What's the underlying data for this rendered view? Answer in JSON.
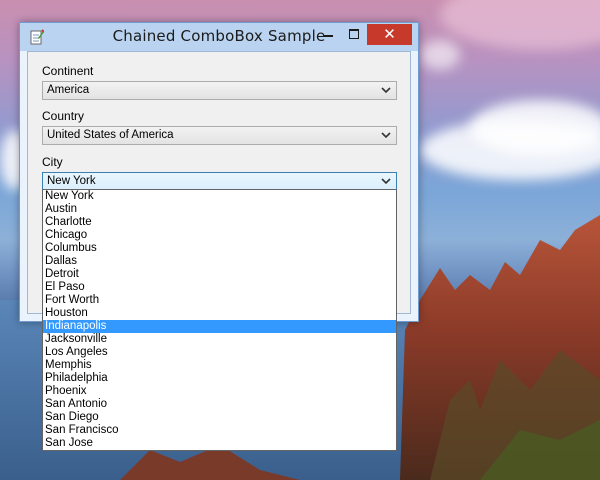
{
  "window": {
    "title": "Chained ComboBox Sample"
  },
  "fields": {
    "continent": {
      "label": "Continent",
      "value": "America"
    },
    "country": {
      "label": "Country",
      "value": "United States of America"
    },
    "city": {
      "label": "City",
      "value": "New York"
    }
  },
  "city_dropdown": {
    "items": [
      "New York",
      "Austin",
      "Charlotte",
      "Chicago",
      "Columbus",
      "Dallas",
      "Detroit",
      "El Paso",
      "Fort Worth",
      "Houston",
      "Indianapolis",
      "Jacksonville",
      "Los Angeles",
      "Memphis",
      "Philadelphia",
      "Phoenix",
      "San Antonio",
      "San Diego",
      "San Francisco",
      "San Jose"
    ],
    "highlighted": "Indianapolis"
  },
  "icons": {
    "app": "notepad-pencil-icon",
    "minimize": "minimize-icon",
    "maximize": "maximize-icon",
    "close": "close-icon",
    "dropdown": "chevron-down-icon"
  },
  "colors": {
    "highlight": "#3399ff",
    "close_button": "#c7392b",
    "titlebar": "#b9d3f0"
  }
}
